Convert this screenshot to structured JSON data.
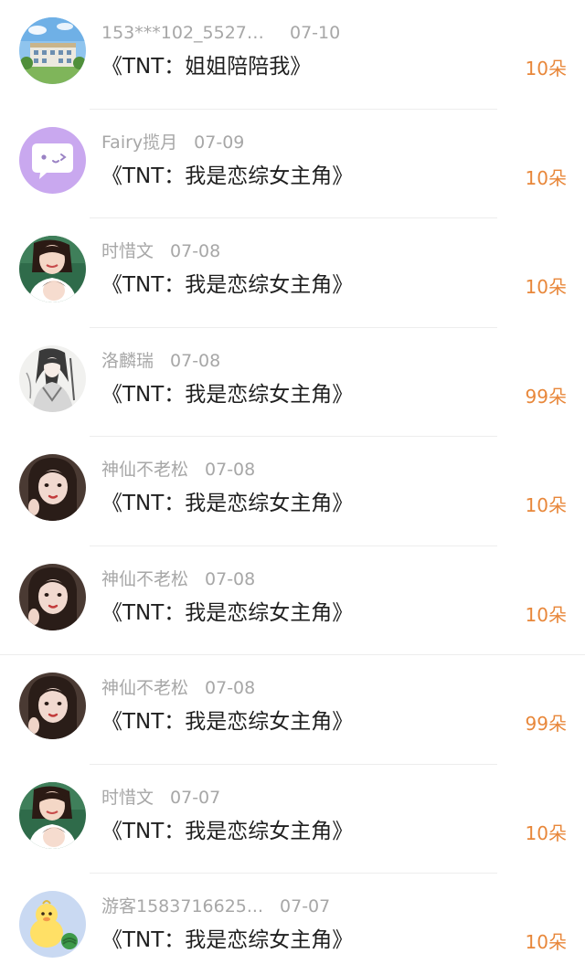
{
  "gift_unit_color": "#e8873a",
  "rows": [
    {
      "username": "153***102_55276...",
      "date": "07-10",
      "title": "《TNT：姐姐陪陪我》",
      "count": "10朵",
      "avatar_icon": "school-building-avatar-icon"
    },
    {
      "username": "Fairy揽月",
      "date": "07-09",
      "title": "《TNT：我是恋综女主角》",
      "count": "10朵",
      "avatar_icon": "purple-chat-bubble-avatar-icon"
    },
    {
      "username": "时惜文",
      "date": "07-08",
      "title": "《TNT：我是恋综女主角》",
      "count": "10朵",
      "avatar_icon": "two-girls-photo-avatar-icon"
    },
    {
      "username": "洛麟瑞",
      "date": "07-08",
      "title": "《TNT：我是恋综女主角》",
      "count": "99朵",
      "avatar_icon": "ink-swordsman-avatar-icon"
    },
    {
      "username": "神仙不老松",
      "date": "07-08",
      "title": "《TNT：我是恋综女主角》",
      "count": "10朵",
      "avatar_icon": "girl-portrait-avatar-icon"
    },
    {
      "username": "神仙不老松",
      "date": "07-08",
      "title": "《TNT：我是恋综女主角》",
      "count": "10朵",
      "avatar_icon": "girl-portrait-avatar-icon"
    },
    {
      "username": "神仙不老松",
      "date": "07-08",
      "title": "《TNT：我是恋综女主角》",
      "count": "99朵",
      "avatar_icon": "girl-portrait-avatar-icon"
    },
    {
      "username": "时惜文",
      "date": "07-07",
      "title": "《TNT：我是恋综女主角》",
      "count": "10朵",
      "avatar_icon": "two-girls-photo-avatar-icon"
    },
    {
      "username": "游客1583716625...",
      "date": "07-07",
      "title": "《TNT：我是恋综女主角》",
      "count": "10朵",
      "avatar_icon": "yellow-duck-avatar-icon"
    }
  ]
}
